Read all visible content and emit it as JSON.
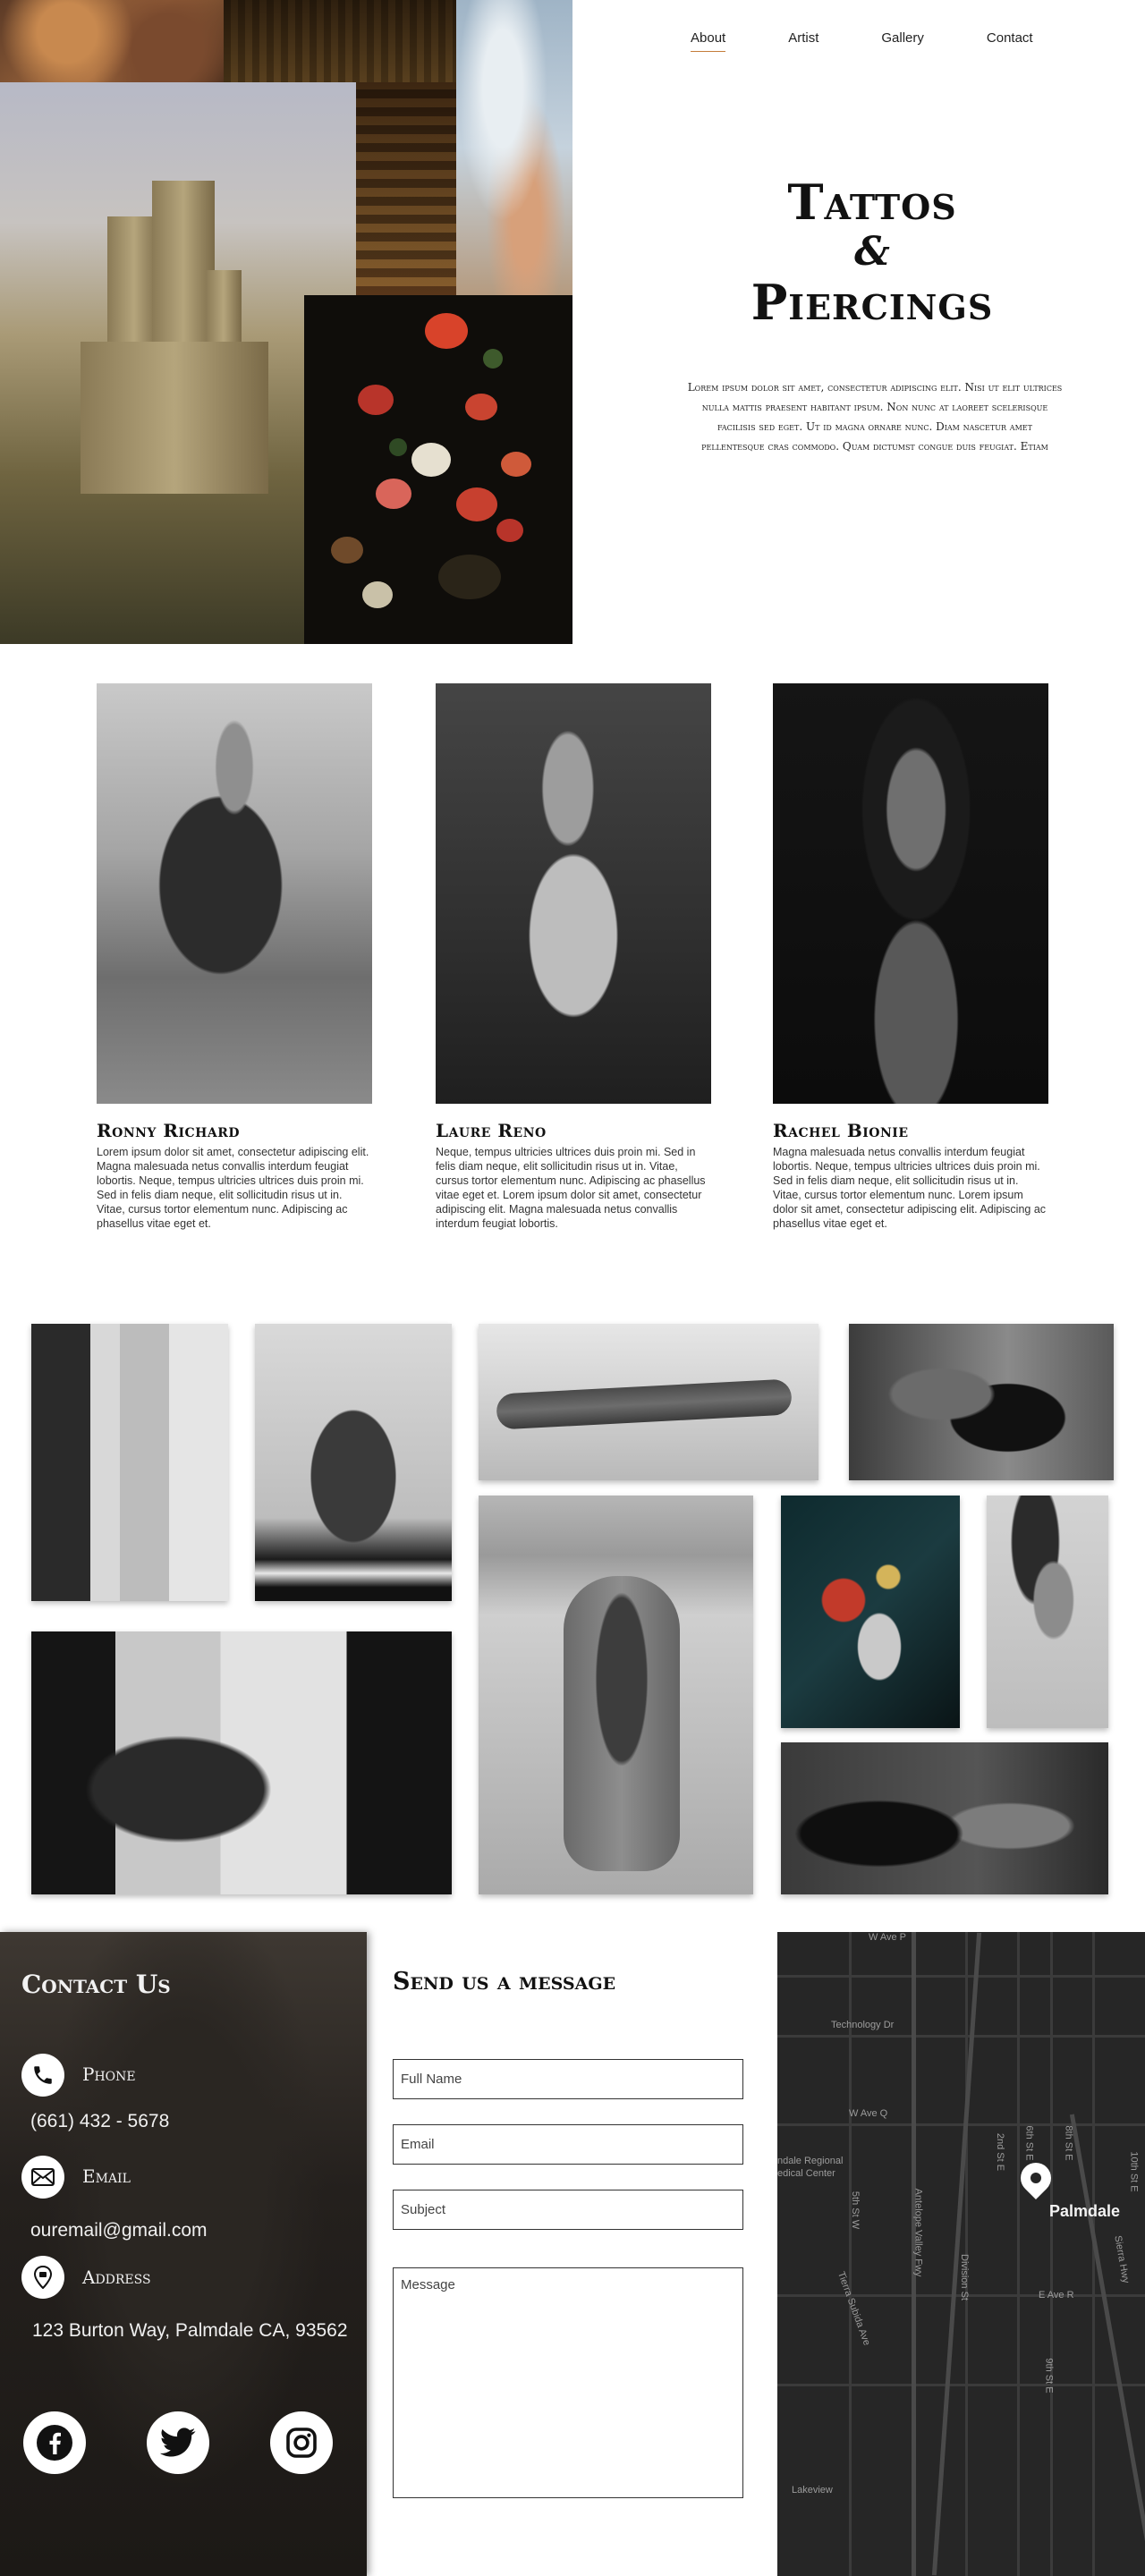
{
  "nav": {
    "items": [
      {
        "label": "About"
      },
      {
        "label": "Artist"
      },
      {
        "label": "Gallery"
      },
      {
        "label": "Contact"
      }
    ],
    "active": "About"
  },
  "hero": {
    "title_line1": "Tattos",
    "title_amp": "&",
    "title_line2": "Piercings",
    "text": "Lorem ipsum dolor sit amet, consectetur adipiscing elit. Nisi ut elit ultrices nulla mattis praesent habitant ipsum. Non nunc at laoreet scelerisque facilisis sed eget. Ut id magna ornare nunc. Diam nascetur amet pellentesque cras commodo. Quam dictumst congue duis feugiat. Etiam"
  },
  "artists": [
    {
      "name": "Ronny  Richard",
      "bio": "Lorem ipsum dolor sit amet, consectetur adipiscing elit. Magna malesuada netus convallis interdum feugiat lobortis. Neque, tempus ultricies ultrices duis proin mi. Sed in felis diam neque, elit sollicitudin risus ut in. Vitae, cursus tortor elementum nunc. Adipiscing ac phasellus vitae eget et."
    },
    {
      "name": "Laure Reno",
      "bio": "Neque, tempus ultricies ultrices duis proin mi. Sed in felis diam neque, elit sollicitudin risus ut in. Vitae, cursus tortor elementum nunc. Adipiscing ac phasellus vitae eget et. Lorem ipsum dolor sit amet, consectetur adipiscing elit. Magna malesuada netus convallis interdum feugiat lobortis."
    },
    {
      "name": "Rachel Bionie",
      "bio": "Magna malesuada netus convallis interdum feugiat lobortis. Neque, tempus ultricies ultrices duis proin mi. Sed in felis diam neque, elit sollicitudin risus ut in. Vitae, cursus tortor elementum nunc. Lorem ipsum dolor sit amet, consectetur adipiscing elit. Adipiscing ac phasellus vitae eget et."
    }
  ],
  "contact": {
    "title": "Contact Us",
    "phone_label": "Phone",
    "phone_value": "(661) 432 - 5678",
    "email_label": "Email",
    "email_value": "ouremail@gmail.com",
    "address_label": "Address",
    "address_value": "123 Burton Way, Palmdale CA, 93562",
    "social": [
      "facebook-icon",
      "twitter-icon",
      "instagram-icon"
    ]
  },
  "form": {
    "title": "Send us a message",
    "full_name_placeholder": "Full Name",
    "email_placeholder": "Email",
    "subject_placeholder": "Subject",
    "message_placeholder": "Message"
  },
  "map": {
    "city": "Palmdale",
    "labels": [
      "W Ave P",
      "Technology Dr",
      "W Ave Q",
      "ndale Regional",
      "edical Center",
      "5th St W",
      "Antelope Valley Fwy",
      "2nd St E",
      "6th St E",
      "8th St E",
      "10th St E",
      "Sierra Hwy",
      "Division St",
      "Tierra Subida Ave",
      "E Ave R",
      "9th St E",
      "Lakeview"
    ]
  },
  "colors": {
    "accent": "#c47c3a",
    "contact_panel": "#24201d",
    "map_bg": "#262626"
  }
}
